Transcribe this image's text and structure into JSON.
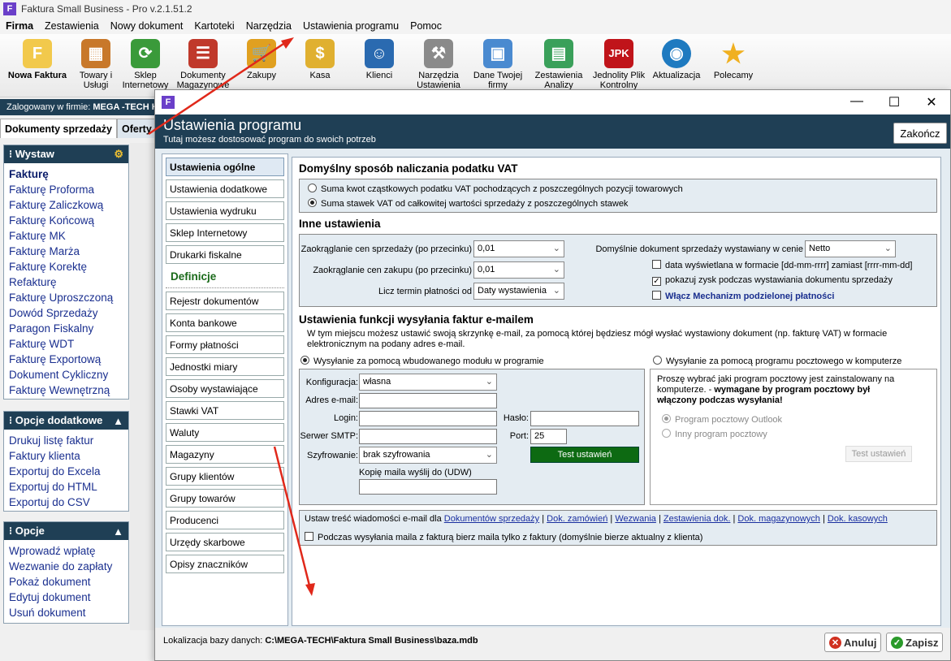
{
  "app": {
    "title": "Faktura Small Business - Pro v.2.1.51.2",
    "logo_letter": "F"
  },
  "menu": [
    "Firma",
    "Zestawienia",
    "Nowy dokument",
    "Kartoteki",
    "Narzędzia",
    "Ustawienia programu",
    "Pomoc"
  ],
  "toolbar": [
    {
      "label": "Nowa Faktura",
      "icon": "document-icon",
      "color": "#f2c94c"
    },
    {
      "label": "Towary i Usługi",
      "icon": "boxes-icon",
      "color": "#c8782a"
    },
    {
      "label": "Sklep Internetowy",
      "icon": "shop-icon",
      "color": "#3a9a3a"
    },
    {
      "label": "Dokumenty Magazynowe",
      "icon": "list-icon",
      "color": "#c0392b"
    },
    {
      "label": "Zakupy",
      "icon": "cart-icon",
      "color": "#e0a020"
    },
    {
      "label": "Kasa",
      "icon": "coins-icon",
      "color": "#e0b030"
    },
    {
      "label": "Klienci",
      "icon": "users-icon",
      "color": "#2a6ab0"
    },
    {
      "label": "Narzędzia Ustawienia",
      "icon": "wrench-icon",
      "color": "#8a8a8a"
    },
    {
      "label": "Dane Twojej firmy",
      "icon": "id-card-icon",
      "color": "#4a8ad0"
    },
    {
      "label": "Zestawienia Analizy",
      "icon": "chart-icon",
      "color": "#3aa05a"
    },
    {
      "label": "Jednolity Plik Kontrolny",
      "icon": "jpk-icon",
      "color": "#c0141a",
      "badge": "JPK"
    },
    {
      "label": "Aktualizacja",
      "icon": "globe-icon",
      "color": "#1e7ac0"
    },
    {
      "label": "Polecamy",
      "icon": "star-icon",
      "color": "#f0b020"
    }
  ],
  "login": {
    "prefix": "Zalogowany w firmie:",
    "company": "MEGA -TECH H"
  },
  "left_tabs": [
    "Dokumenty sprzedaży",
    "Oferty / Z"
  ],
  "panels": {
    "wystaw": {
      "title": "Wystaw",
      "items": [
        "Fakturę",
        "Fakturę Proforma",
        "Fakturę Zaliczkową",
        "Fakturę Końcową",
        "Fakturę MK",
        "Fakturę Marża",
        "Fakturę Korektę",
        "Refakturę",
        "Fakturę Uproszczoną",
        "Dowód Sprzedaży",
        "Paragon Fiskalny",
        "Fakturę WDT",
        "Fakturę Exportową",
        "Dokument Cykliczny",
        "Fakturę Wewnętrzną"
      ]
    },
    "opcje_dod": {
      "title": "Opcje dodatkowe",
      "items": [
        "Drukuj listę faktur",
        "Faktury klienta",
        "Exportuj do Excela",
        "Exportuj do HTML",
        "Exportuj do CSV"
      ]
    },
    "opcje": {
      "title": "Opcje",
      "items": [
        "Wprowadź wpłatę",
        "Wezwanie do zapłaty",
        "Pokaż dokument",
        "Edytuj dokument",
        "Usuń dokument"
      ]
    }
  },
  "dialog": {
    "title": "Ustawienia programu",
    "subtitle": "Tutaj możesz dostosować program do swoich potrzeb",
    "close_label": "Zakończ",
    "nav_top": [
      "Ustawienia ogólne",
      "Ustawienia dodatkowe",
      "Ustawienia wydruku",
      "Sklep Internetowy",
      "Drukarki fiskalne"
    ],
    "nav_section": "Definicje",
    "nav_defs": [
      "Rejestr dokumentów",
      "Konta bankowe",
      "Formy płatności",
      "Jednostki miary",
      "Osoby wystawiające",
      "Stawki VAT",
      "Waluty",
      "Magazyny",
      "Grupy klientów",
      "Grupy towarów",
      "Producenci",
      "Urzędy skarbowe",
      "Opisy znaczników"
    ],
    "vat": {
      "title": "Domyślny sposób naliczania podatku VAT",
      "opt1": "Suma kwot cząstkowych podatku VAT pochodzących z poszczególnych pozycji towarowych",
      "opt2": "Suma stawek VAT od całkowitej wartości sprzedaży z poszczególnych stawek"
    },
    "other": {
      "title": "Inne ustawienia",
      "round_sale_label": "Zaokrąglanie cen sprzedaży (po przecinku)",
      "round_sale_value": "0,01",
      "round_buy_label": "Zaokrąglanie cen zakupu (po przecinku)",
      "round_buy_value": "0,01",
      "term_label": "Licz termin płatności od",
      "term_value": "Daty wystawienia",
      "default_doc_label": "Domyślnie dokument sprzedaży wystawiany w cenie",
      "default_doc_value": "Netto",
      "chk_date": "data wyświetlana w formacie [dd-mm-rrrr] zamiast [rrrr-mm-dd]",
      "chk_profit": "pokazuj zysk podczas wystawiania dokumentu sprzedaży",
      "chk_split": "Włącz Mechanizm podzielonej płatności"
    },
    "email": {
      "title": "Ustawienia funkcji wysyłania faktur e-mailem",
      "desc": "W tym miejscu możesz ustawić swoją skrzynkę e-mail, za pomocą której będziesz mógł wysłać wystawiony dokument (np. fakturę VAT) w formacie elektronicznym na podany adres e-mail.",
      "opt_builtin": "Wysyłanie za pomocą wbudowanego modułu w programie",
      "opt_client": "Wysyłanie za pomocą programu pocztowego w komputerze",
      "config_label": "Konfiguracja:",
      "config_value": "własna",
      "address_label": "Adres e-mail:",
      "login_label": "Login:",
      "password_label": "Hasło:",
      "smtp_label": "Serwer SMTP:",
      "port_label": "Port:",
      "port_value": "25",
      "enc_label": "Szyfrowanie:",
      "enc_value": "brak szyfrowania",
      "test_label": "Test ustawień",
      "copy_label": "Kopię maila wyślij do (UDW)",
      "client_note_1": "Proszę wybrać jaki program pocztowy jest zainstalowany na komputerze. - ",
      "client_note_bold": "wymagane by program pocztowy był włączony podczas wysyłania!",
      "client_outlook": "Program pocztowy Outlook",
      "client_other": "Inny program pocztowy",
      "client_test": "Test ustawień",
      "content_prefix": "Ustaw treść wiadomości e-mail dla",
      "content_links": [
        "Dokumentów sprzedaży",
        "Dok. zamówień",
        "Wezwania",
        "Zestawienia dok.",
        "Dok. magazynowych",
        "Dok. kasowych"
      ],
      "chk_client_mail": "Podczas wysyłania maila z fakturą bierz maila tylko z faktury (domyślnie bierze aktualny z klienta)"
    },
    "footer": {
      "db_label": "Lokalizacja bazy danych:",
      "db_path": "C:\\MEGA-TECH\\Faktura Small Business\\baza.mdb",
      "cancel": "Anuluj",
      "save": "Zapisz"
    }
  },
  "colors": {
    "header_navy": "#1f3f55",
    "arrow_red": "#e0281a",
    "green_btn": "#0d6a12",
    "link_blue": "#1a2fa0"
  }
}
